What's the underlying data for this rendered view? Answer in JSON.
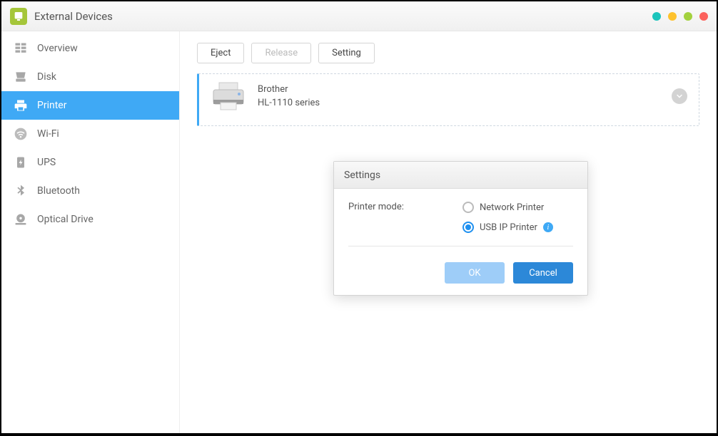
{
  "titlebar": {
    "title": "External Devices"
  },
  "sidebar": {
    "items": [
      {
        "label": "Overview"
      },
      {
        "label": "Disk"
      },
      {
        "label": "Printer"
      },
      {
        "label": "Wi-Fi"
      },
      {
        "label": "UPS"
      },
      {
        "label": "Bluetooth"
      },
      {
        "label": "Optical Drive"
      }
    ]
  },
  "toolbar": {
    "eject_label": "Eject",
    "release_label": "Release",
    "setting_label": "Setting"
  },
  "device": {
    "name": "Brother",
    "model": "HL-1110 series"
  },
  "dialog": {
    "title": "Settings",
    "mode_label": "Printer mode:",
    "options": {
      "network": "Network Printer",
      "usbip": "USB IP Printer"
    },
    "ok_label": "OK",
    "cancel_label": "Cancel"
  }
}
